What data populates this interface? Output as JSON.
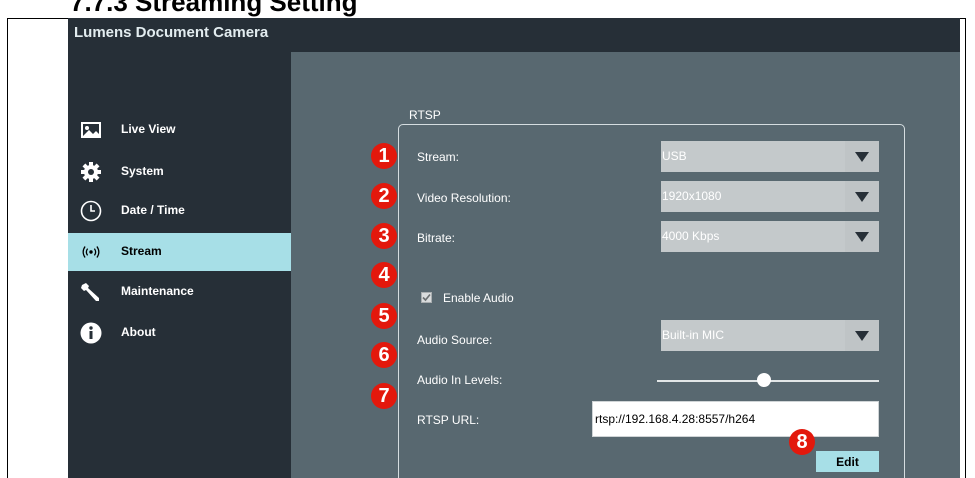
{
  "document": {
    "heading": "7.7.3 Streaming Setting"
  },
  "app": {
    "title": "Lumens Document Camera"
  },
  "sidebar": {
    "items": [
      {
        "label": "Live View",
        "icon": "image-icon",
        "active": false
      },
      {
        "label": "System",
        "icon": "gear-icon",
        "active": false
      },
      {
        "label": "Date / Time",
        "icon": "clock-icon",
        "active": false
      },
      {
        "label": "Stream",
        "icon": "broadcast-icon",
        "active": true
      },
      {
        "label": "Maintenance",
        "icon": "wrench-icon",
        "active": false
      },
      {
        "label": "About",
        "icon": "info-icon",
        "active": false
      }
    ]
  },
  "rtsp": {
    "section_title": "RTSP",
    "stream": {
      "label": "Stream:",
      "value": "USB"
    },
    "resolution": {
      "label": "Video Resolution:",
      "value": "1920x1080"
    },
    "bitrate": {
      "label": "Bitrate:",
      "value": "4000 Kbps"
    },
    "audio_enable": {
      "label": "Enable Audio",
      "checked": true
    },
    "audio_source": {
      "label": "Audio Source:",
      "value": "Built-in MIC"
    },
    "audio_level": {
      "label": "Audio In Levels:",
      "level_fraction": 0.48
    },
    "url": {
      "label": "RTSP URL:",
      "value": "rtsp://192.168.4.28:8557/h264"
    },
    "edit_label": "Edit"
  },
  "callouts": [
    "1",
    "2",
    "3",
    "4",
    "5",
    "6",
    "7",
    "8"
  ],
  "colors": {
    "sidebar_bg": "#262f37",
    "content_bg": "#586870",
    "accent": "#a7dfe7",
    "callout": "#e3180c"
  }
}
